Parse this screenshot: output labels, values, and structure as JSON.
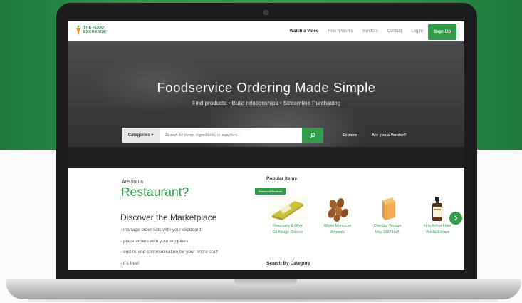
{
  "nav": {
    "logo_line1": "THE FOOD",
    "logo_line2": "EXCHANGE",
    "links": [
      "Watch a Video",
      "How it Works",
      "Vendors",
      "Contact",
      "Log In"
    ],
    "signup_label": "Sign Up"
  },
  "hero": {
    "title": "Foodservice Ordering Made Simple",
    "subtitle": "Find products • Build relationships • Streamline Purchasing"
  },
  "search": {
    "category_label": "Categories ▾",
    "placeholder": "Search for items, ingredients, or suppliers...",
    "explore_label": "Explore",
    "vendor_label": "Are you a Vendor?"
  },
  "intro": {
    "are_you": "Are you a",
    "role": "Restaurant?",
    "heading": "Discover the Marketplace",
    "bullets": [
      "- manage order lists with your clipboard",
      "- place orders with your suppliers",
      "- end-to-end communication for your entire staff",
      "- it's free!"
    ]
  },
  "popular": {
    "title": "Popular Items",
    "featured_badge": "Featured Product",
    "products": [
      {
        "name_line1": "Rosemary & Olive",
        "name_line2": "Oil Asiago Cheese",
        "icon": "cheese-wedge"
      },
      {
        "name_line1": "Whole Moroccan",
        "name_line2": "Almonds",
        "icon": "almonds"
      },
      {
        "name_line1": "Cheddar Vintage",
        "name_line2": "May 1997 Half.",
        "icon": "cheddar-block"
      },
      {
        "name_line1": "King Arthur Flour",
        "name_line2": "Vanilla Extract",
        "icon": "extract-bottle"
      }
    ],
    "search_by_category": "Search By Category"
  },
  "colors": {
    "brand_green": "#2e9c48",
    "hero_dark": "#3b3d3f",
    "background_green": "#2f9a4c"
  }
}
